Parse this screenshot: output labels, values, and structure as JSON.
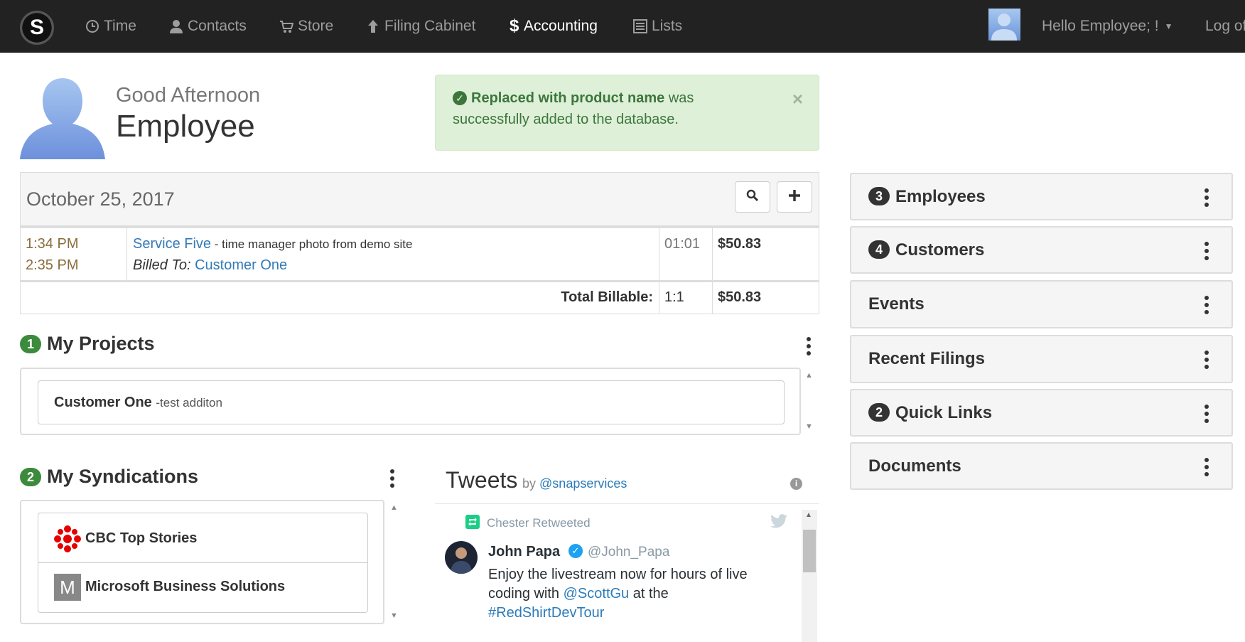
{
  "nav": {
    "logo_letter": "S",
    "items": [
      {
        "label": "Time",
        "icon": "clock-icon"
      },
      {
        "label": "Contacts",
        "icon": "user-icon"
      },
      {
        "label": "Store",
        "icon": "cart-icon"
      },
      {
        "label": "Filing Cabinet",
        "icon": "arrow-up-icon"
      },
      {
        "label": "Accounting",
        "icon": "dollar-icon"
      },
      {
        "label": "Lists",
        "icon": "list-icon"
      }
    ],
    "active_item": "Accounting",
    "user_greeting": "Hello Employee; !",
    "logout": "Log of"
  },
  "greeting": {
    "line1": "Good Afternoon",
    "line2": "Employee"
  },
  "alert": {
    "bold": "Replaced with product name",
    "rest": " was",
    "line2": "successfully added to the database.",
    "close": "×"
  },
  "timesheet": {
    "date": "October 25, 2017",
    "entry": {
      "start": "1:34 PM",
      "end": "2:35 PM",
      "service": "Service Five",
      "description": " - time manager photo from demo site",
      "billed_label": "Billed To:",
      "customer": "Customer One",
      "duration": "01:01",
      "amount": "$50.83"
    },
    "total_label": "Total Billable:",
    "total_duration": "1:1",
    "total_amount": "$50.83"
  },
  "projects": {
    "count": "1",
    "title": "My Projects",
    "items": [
      {
        "name": "Customer One",
        "note": "-test additon"
      }
    ]
  },
  "syndications": {
    "count": "2",
    "title": "My Syndications",
    "items": [
      {
        "name": "CBC Top Stories",
        "icon": "cbc-logo-icon"
      },
      {
        "name": "Microsoft Business Solutions",
        "icon_letter": "M"
      }
    ]
  },
  "tweets": {
    "title": "Tweets",
    "by": "by",
    "handle": "@snapservices",
    "retweeted_by": "Chester Retweeted",
    "author_name": "John Papa",
    "author_handle": "@John_Papa",
    "text_1": "Enjoy the livestream now for hours of live",
    "text_2a": "coding with ",
    "mention": "@ScottGu",
    "text_2b": " at the",
    "hashtag": "#RedShirtDevTour"
  },
  "right_panels": [
    {
      "count": "3",
      "title": "Employees"
    },
    {
      "count": "4",
      "title": "Customers"
    },
    {
      "count": "",
      "title": "Events"
    },
    {
      "count": "",
      "title": "Recent Filings"
    },
    {
      "count": "2",
      "title": "Quick Links"
    },
    {
      "count": "",
      "title": "Documents"
    }
  ],
  "colors": {
    "navbar": "#222222",
    "success_bg": "#dff0d8",
    "success_text": "#3c763d",
    "link": "#337ab7",
    "badge_green": "#3c8a3c"
  }
}
